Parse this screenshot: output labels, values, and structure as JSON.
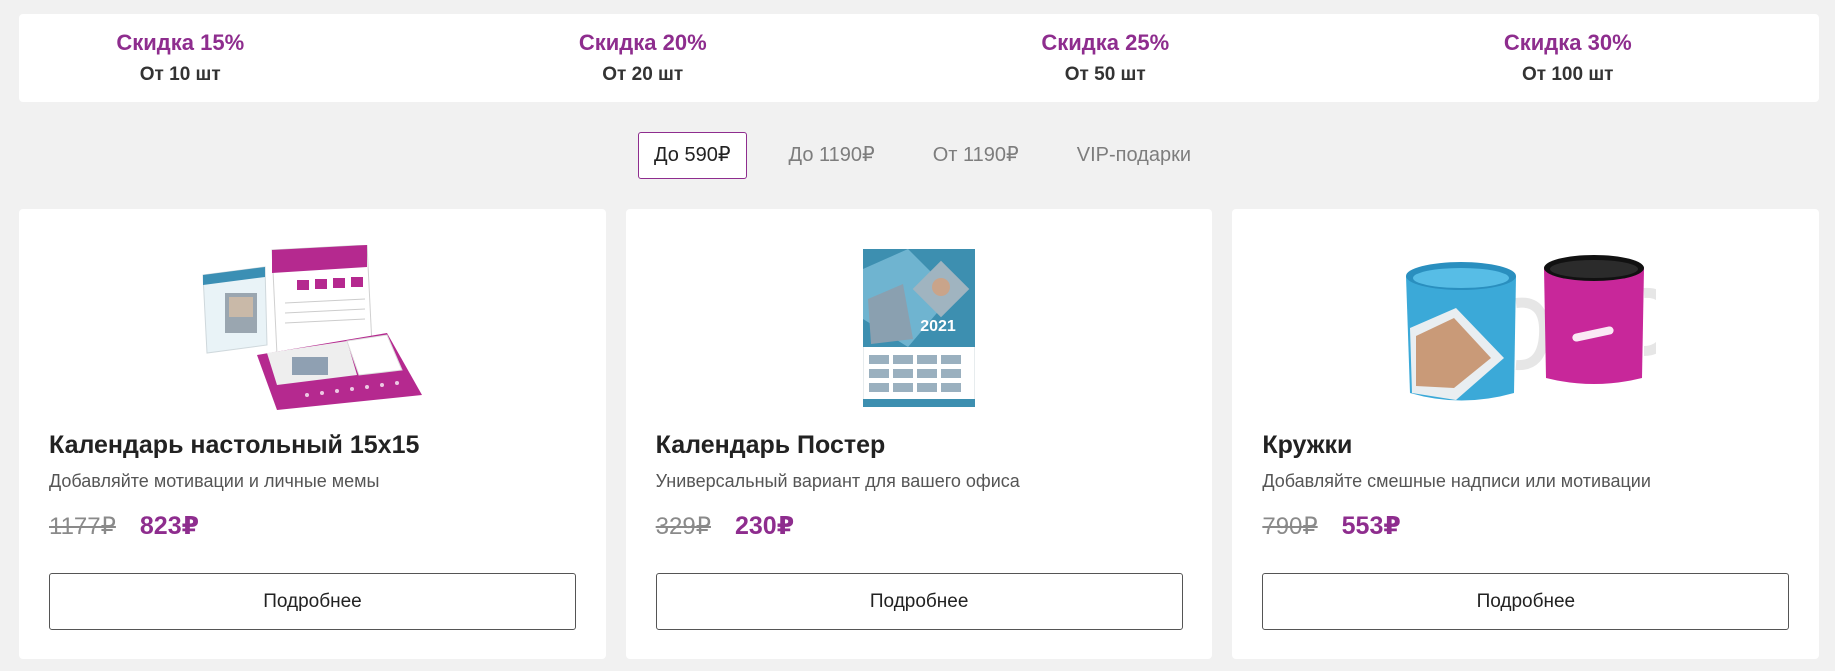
{
  "discounts": [
    {
      "title": "Скидка 15%",
      "subtitle": "От 10 шт"
    },
    {
      "title": "Скидка 20%",
      "subtitle": "От 20 шт"
    },
    {
      "title": "Скидка 25%",
      "subtitle": "От 50 шт"
    },
    {
      "title": "Скидка 30%",
      "subtitle": "От 100 шт"
    }
  ],
  "tabs": [
    {
      "label": "До 590₽",
      "active": true
    },
    {
      "label": "До 1190₽",
      "active": false
    },
    {
      "label": "От 1190₽",
      "active": false
    },
    {
      "label": "VIP-подарки",
      "active": false
    }
  ],
  "products": [
    {
      "title": "Календарь настольный 15х15",
      "description": "Добавляйте мотивации и личные мемы",
      "old_price": "1177₽",
      "new_price": "823₽",
      "button": "Подробнее",
      "image_icon": "desk-calendar-image"
    },
    {
      "title": "Календарь Постер",
      "description": "Универсальный вариант для вашего офиса",
      "old_price": "329₽",
      "new_price": "230₽",
      "button": "Подробнее",
      "image_icon": "poster-calendar-image",
      "image_text": "2021"
    },
    {
      "title": "Кружки",
      "description": "Добавляйте смешные надписи или мотивации",
      "old_price": "790₽",
      "new_price": "553₽",
      "button": "Подробнее",
      "image_icon": "mugs-image"
    }
  ],
  "colors": {
    "accent": "#8e2d8e",
    "background": "#f1f1f1",
    "poster_blue": "#3d8fb0",
    "mug_blue": "#3ba9d8",
    "mug_pink": "#c8279a"
  }
}
